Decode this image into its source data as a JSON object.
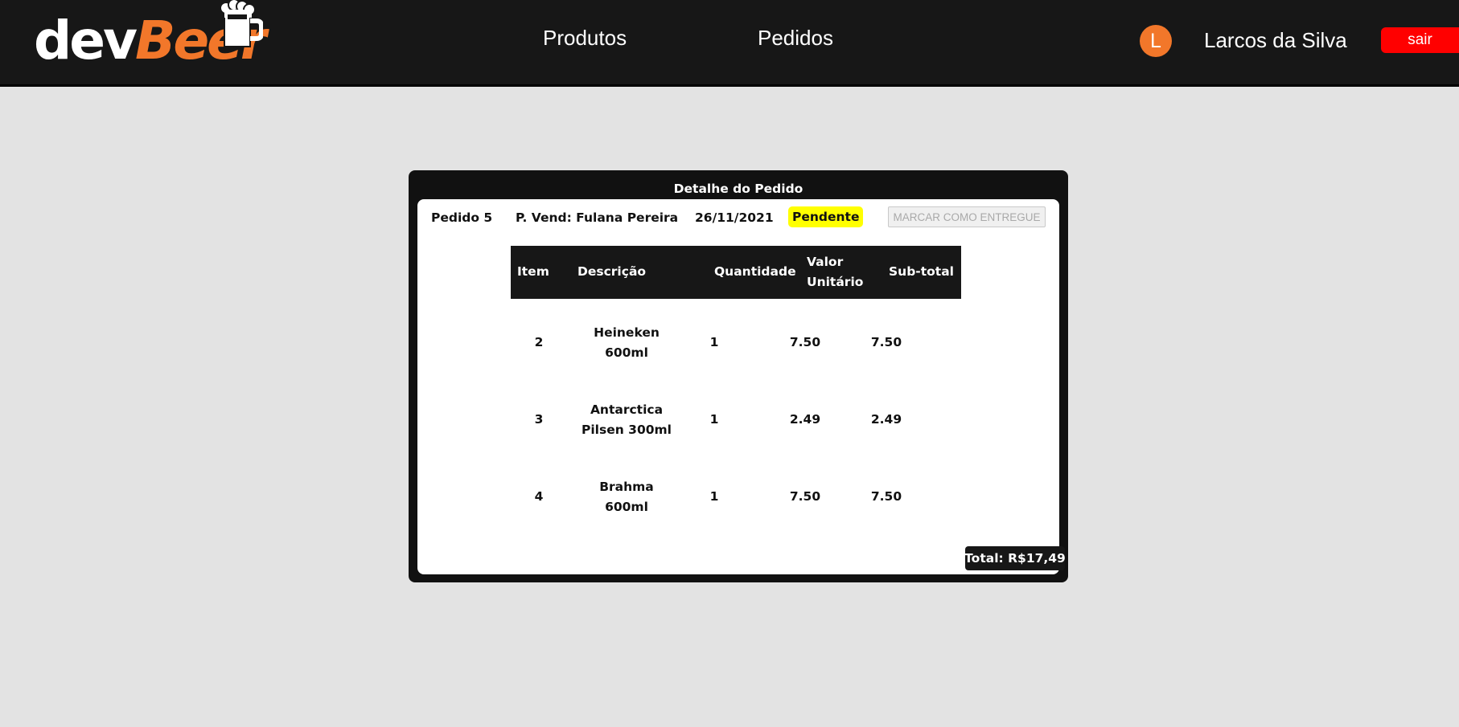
{
  "header": {
    "logo_dev": "dev",
    "logo_beer": "Beer",
    "nav": [
      {
        "label": "Produtos"
      },
      {
        "label": "Pedidos"
      }
    ],
    "avatar_initial": "L",
    "user_name": "Larcos da Silva",
    "logout_label": "sair",
    "colors": {
      "accent": "#f2772a",
      "bar": "#171717",
      "logout": "#ff0000"
    }
  },
  "order": {
    "panel_title": "Detalhe do Pedido",
    "order_label": "Pedido 5",
    "seller": "P. Vend: Fulana Pereira",
    "date": "26/11/2021",
    "status": "Pendente",
    "status_color": "#ffff00",
    "mark_delivered_label": "MARCAR COMO ENTREGUE",
    "columns": [
      "Item",
      "Descrição",
      "Quantidade",
      "Valor",
      "Unitário",
      "Sub-total"
    ],
    "rows": [
      {
        "item": "2",
        "desc_1": "Heineken",
        "desc_2": "600ml",
        "qty": "1",
        "unit": "7.50",
        "subtotal": "7.50"
      },
      {
        "item": "3",
        "desc_1": "Antarctica",
        "desc_2": "Pilsen 300ml",
        "qty": "1",
        "unit": "2.49",
        "subtotal": "2.49"
      },
      {
        "item": "4",
        "desc_1": "Brahma",
        "desc_2": "600ml",
        "qty": "1",
        "unit": "7.50",
        "subtotal": "7.50"
      }
    ],
    "total_label": "Total: R$17,49"
  }
}
